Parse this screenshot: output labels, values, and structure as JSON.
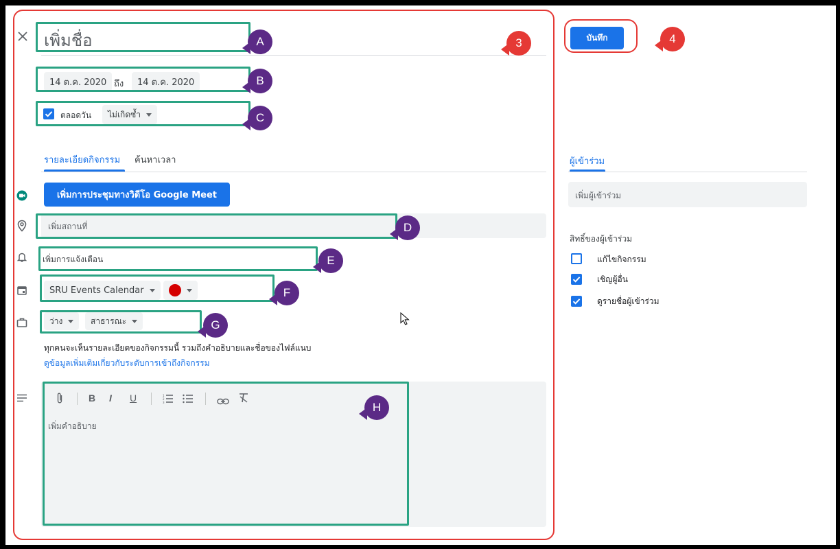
{
  "event": {
    "title_placeholder": "เพิ่มชื่อ",
    "start_date": "14 ต.ค. 2020",
    "to_label": "ถึง",
    "end_date": "14 ต.ค. 2020",
    "all_day_label": "ตลอดวัน",
    "repeat_value": "ไม่เกิดซ้ำ",
    "save_label": "บันทึก"
  },
  "tabs": [
    {
      "label": "รายละเอียดกิจกรรม"
    },
    {
      "label": "ค้นหาเวลา"
    }
  ],
  "details": {
    "meet_button": "เพิ่มการประชุมทางวิดีโอ Google Meet",
    "location_placeholder": "เพิ่มสถานที่",
    "notification_placeholder": "เพิ่มการแจ้งเตือน",
    "calendar_name": "SRU Events Calendar",
    "event_color": "#d50000",
    "busy_status": "ว่าง",
    "visibility": "สาธารณะ",
    "visibility_note": "ทุกคนจะเห็นรายละเอียดของกิจกรรมนี้ รวมถึงคำอธิบายและชื่อของไฟล์แนบ",
    "visibility_link": "ดูข้อมูลเพิ่มเติมเกี่ยวกับระดับการเข้าถึงกิจกรรม",
    "description_placeholder": "เพิ่มคำอธิบาย",
    "toolbar": {
      "bold": "B",
      "italic": "I",
      "underline": "U"
    }
  },
  "guests": {
    "tab_label": "ผู้เข้าร่วม",
    "add_placeholder": "เพิ่มผู้เข้าร่วม",
    "permissions_title": "สิทธิ์ของผู้เข้าร่วม",
    "permissions": [
      {
        "label": "แก้ไขกิจกรรม",
        "checked": false
      },
      {
        "label": "เชิญผู้อื่น",
        "checked": true
      },
      {
        "label": "ดูรายชื่อผู้เข้าร่วม",
        "checked": true
      }
    ]
  },
  "callouts": {
    "A": "A",
    "B": "B",
    "C": "C",
    "D": "D",
    "E": "E",
    "F": "F",
    "G": "G",
    "H": "H",
    "three": "3",
    "four": "4"
  },
  "colors": {
    "accent_blue": "#1a73e8",
    "callout_purple": "#5b2a86",
    "callout_red": "#e53935",
    "highlight_green": "#2aa383",
    "meet_green": "#00897b"
  }
}
